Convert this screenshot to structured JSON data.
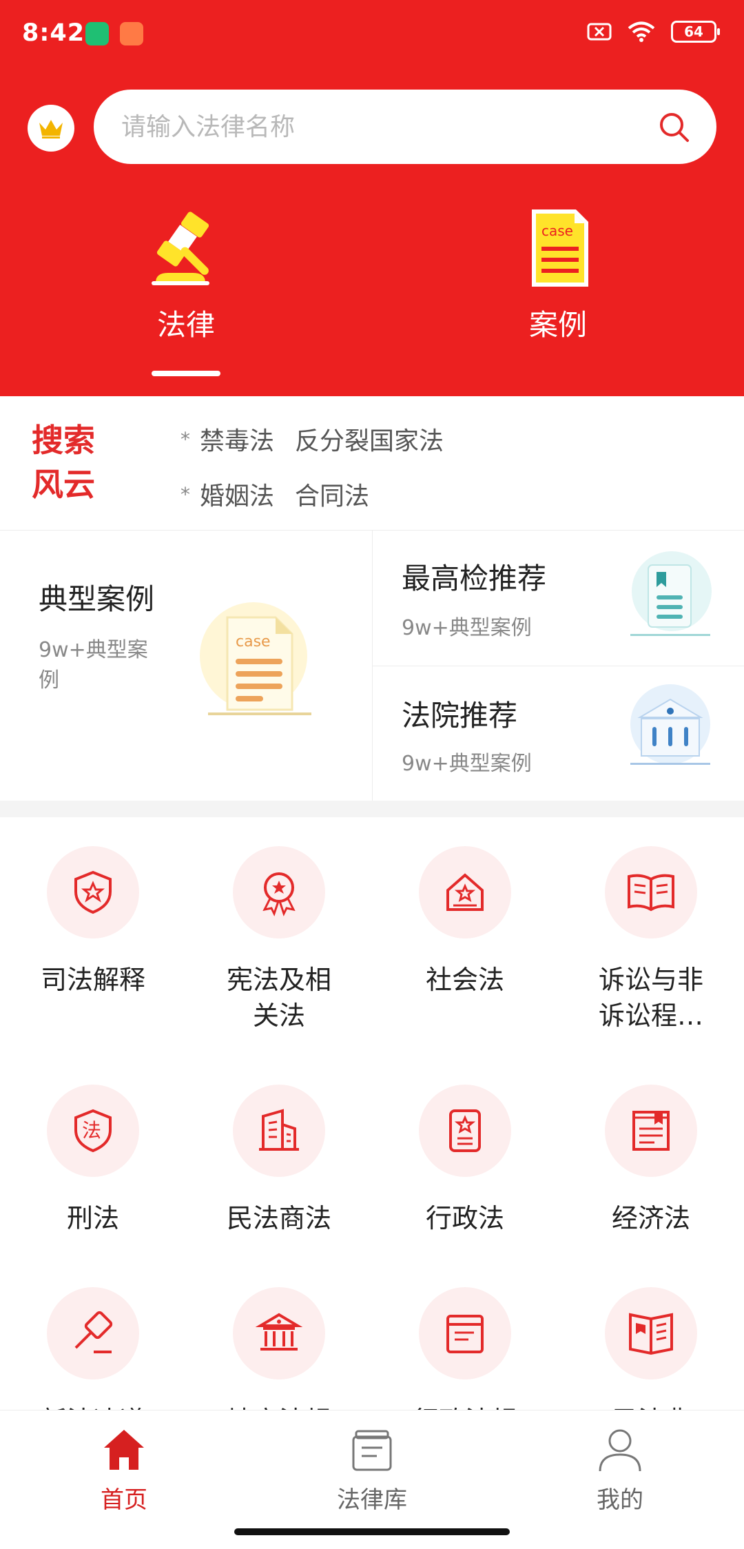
{
  "status": {
    "time": "8:42",
    "battery": "64"
  },
  "search": {
    "placeholder": "请输入法律名称"
  },
  "tabs": [
    {
      "label": "法律",
      "active": true
    },
    {
      "label": "案例",
      "active": false
    }
  ],
  "hot_searches": {
    "title": "搜索风云",
    "rows": [
      [
        "禁毒法",
        "反分裂国家法"
      ],
      [
        "婚姻法",
        "合同法"
      ]
    ],
    "marker": "*"
  },
  "recommend": {
    "typical": {
      "title": "典型案例",
      "subtitle": "9w+典型案例",
      "icon": "case-document-icon"
    },
    "procuratorate": {
      "title": "最高检推荐",
      "subtitle": "9w+典型案例",
      "icon": "bookmark-document-icon"
    },
    "court": {
      "title": "法院推荐",
      "subtitle": "9w+典型案例",
      "icon": "courthouse-icon"
    }
  },
  "grid": [
    {
      "label": "司法解释",
      "icon": "shield-star-icon"
    },
    {
      "label": "宪法及相关法",
      "icon": "award-medal-icon"
    },
    {
      "label": "社会法",
      "icon": "house-star-icon"
    },
    {
      "label": "诉讼与非诉讼程…",
      "icon": "open-book-icon"
    },
    {
      "label": "刑法",
      "icon": "shield-law-icon"
    },
    {
      "label": "民法商法",
      "icon": "building-icon"
    },
    {
      "label": "行政法",
      "icon": "badge-star-icon"
    },
    {
      "label": "经济法",
      "icon": "ledger-icon"
    },
    {
      "label": "新法速递",
      "icon": "gavel-icon"
    },
    {
      "label": "地方法规",
      "icon": "institution-icon"
    },
    {
      "label": "行政法规",
      "icon": "archive-box-icon"
    },
    {
      "label": "民法典",
      "icon": "code-book-icon"
    }
  ],
  "bottom_nav": [
    {
      "label": "首页",
      "icon": "home-icon",
      "active": true
    },
    {
      "label": "法律库",
      "icon": "law-library-icon",
      "active": false
    },
    {
      "label": "我的",
      "icon": "profile-icon",
      "active": false
    }
  ],
  "colors": {
    "brand_red": "#ec2020",
    "accent_red": "#e32a2a",
    "icon_bg": "#fdeeee"
  }
}
